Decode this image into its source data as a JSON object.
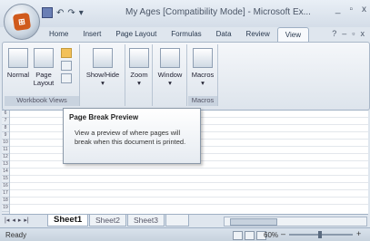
{
  "window": {
    "title": "My Ages  [Compatibility Mode] - Microsoft Ex...",
    "controls": [
      "_",
      "▫",
      "x"
    ]
  },
  "qat": {
    "save_icon": "save-icon",
    "undo": "↶",
    "redo": "↷",
    "more": "▾"
  },
  "tabs": [
    "Home",
    "Insert",
    "Page Layout",
    "Formulas",
    "Data",
    "Review",
    "View"
  ],
  "active_tab": "View",
  "help_controls": [
    "?",
    "–",
    "▫",
    "x"
  ],
  "ribbon": {
    "workbook_views": {
      "label": "Workbook Views",
      "normal": "Normal",
      "page_layout_line1": "Page",
      "page_layout_line2": "Layout"
    },
    "show_hide": "Show/Hide",
    "zoom": "Zoom",
    "window": "Window",
    "macros": {
      "button": "Macros",
      "label": "Macros"
    }
  },
  "rows": [
    "6",
    "7",
    "8",
    "9",
    "10",
    "11",
    "12",
    "13",
    "14",
    "15",
    "16",
    "17",
    "18",
    "19"
  ],
  "tooltip": {
    "title": "Page Break Preview",
    "body": "View a preview of where pages will break when this document is printed."
  },
  "sheet_tabs": [
    "Sheet1",
    "Sheet2",
    "Sheet3"
  ],
  "status": {
    "ready": "Ready",
    "zoom": "60%",
    "minus": "–",
    "plus": "+"
  }
}
